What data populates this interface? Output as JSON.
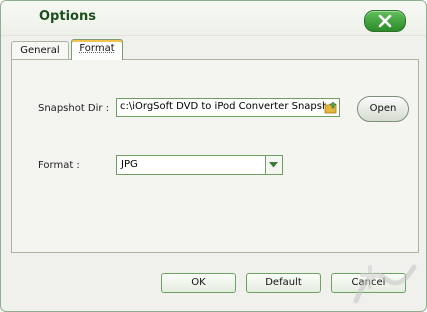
{
  "window": {
    "title": "Options"
  },
  "tabs": [
    {
      "label": "General",
      "active": false
    },
    {
      "label": "Format",
      "active": true
    }
  ],
  "snapshot": {
    "label": "Snapshot Dir :",
    "value": "c:\\iOrgSoft DVD to iPod Converter Snapsho",
    "open_label": "Open"
  },
  "format": {
    "label": "Format :",
    "selected": "JPG"
  },
  "buttons": {
    "ok": "OK",
    "default": "Default",
    "cancel": "Cancel"
  },
  "colors": {
    "accent": "#2c8b2a",
    "title_text": "#1e4f1e",
    "border": "#6f9e62"
  }
}
